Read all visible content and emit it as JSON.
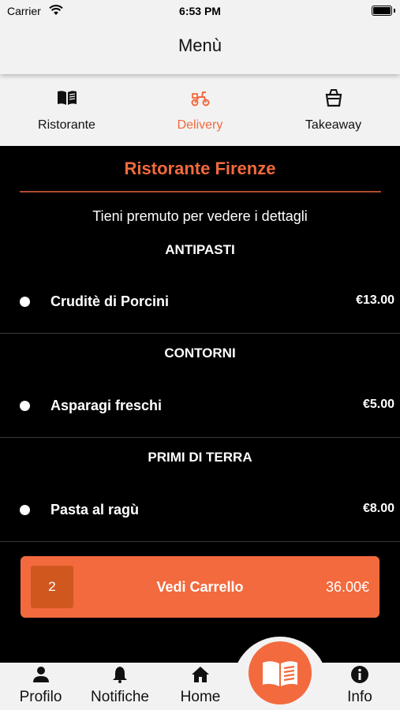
{
  "status_bar": {
    "carrier": "Carrier",
    "time": "6:53 PM"
  },
  "nav": {
    "title": "Menù"
  },
  "tabs": [
    {
      "label": "Ristorante",
      "icon": "book-open-icon",
      "active": false
    },
    {
      "label": "Delivery",
      "icon": "scooter-icon",
      "active": true
    },
    {
      "label": "Takeaway",
      "icon": "bag-icon",
      "active": false
    }
  ],
  "restaurant": {
    "name": "Ristorante Firenze",
    "hint": "Tieni premuto per vedere i dettagli"
  },
  "sections": [
    {
      "title": "ANTIPASTI",
      "items": [
        {
          "name": "Cruditè di Porcini",
          "price": "€13.00"
        }
      ]
    },
    {
      "title": "CONTORNI",
      "items": [
        {
          "name": "Asparagi freschi",
          "price": "€5.00"
        }
      ]
    },
    {
      "title": "PRIMI DI TERRA",
      "items": [
        {
          "name": "Pasta al ragù",
          "price": "€8.00"
        }
      ]
    }
  ],
  "cart": {
    "quantity": "2",
    "label": "Vedi Carrello",
    "total": "36.00€"
  },
  "bottom_nav": [
    {
      "label": "Profilo",
      "icon": "person-icon"
    },
    {
      "label": "Notifiche",
      "icon": "bell-icon"
    },
    {
      "label": "Home",
      "icon": "home-icon"
    },
    {
      "label": "Info",
      "icon": "info-icon"
    }
  ],
  "center_button": {
    "icon": "menu-book-icon"
  },
  "colors": {
    "accent": "#f26a3d",
    "background": "#000000",
    "bar": "#f2f2f2"
  }
}
